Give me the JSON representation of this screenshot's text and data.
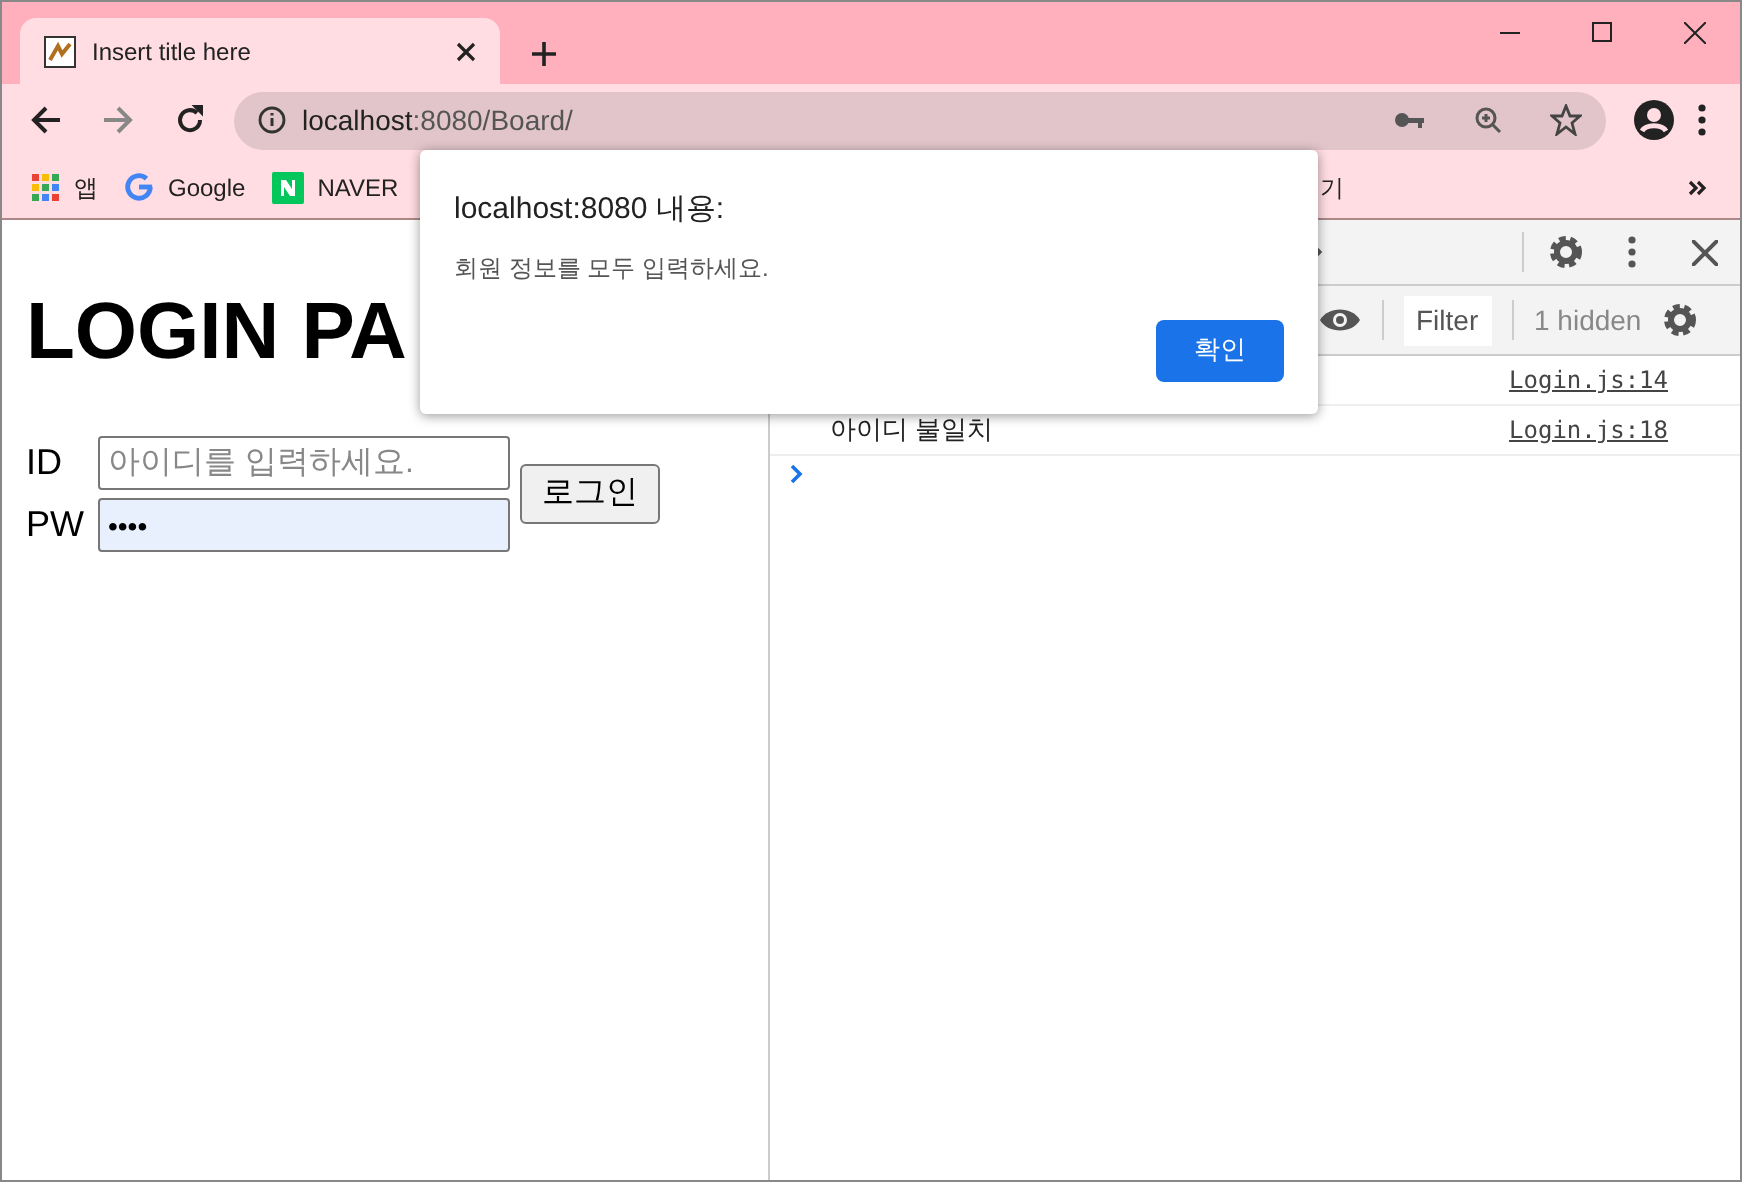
{
  "tab": {
    "title": "Insert title here",
    "selected": true
  },
  "address_bar": {
    "url_host": "localhost",
    "url_rest": ":8080/Board/"
  },
  "bookmarks": [
    {
      "label": "앱",
      "kind": "apps"
    },
    {
      "label": "Google",
      "kind": "google"
    },
    {
      "label": "NAVER",
      "kind": "naver"
    },
    {
      "label": "기",
      "kind": "folder"
    }
  ],
  "page": {
    "heading": "LOGIN PA",
    "id_label": "ID",
    "id_placeholder": "아이디를 입력하세요.",
    "pw_label": "PW",
    "pw_value": "••••",
    "pw_autofilled": true,
    "login_button": "로그인"
  },
  "devtools": {
    "filter_placeholder": "Filter",
    "hidden_count": "1 hidden",
    "console": [
      {
        "source": "Login.js:14"
      },
      {
        "message": "아이디 불일치",
        "source": "Login.js:18"
      }
    ]
  },
  "dialog": {
    "title": "localhost:8080 내용:",
    "message": "회원 정보를 모두 입력하세요.",
    "ok_button": "확인"
  }
}
